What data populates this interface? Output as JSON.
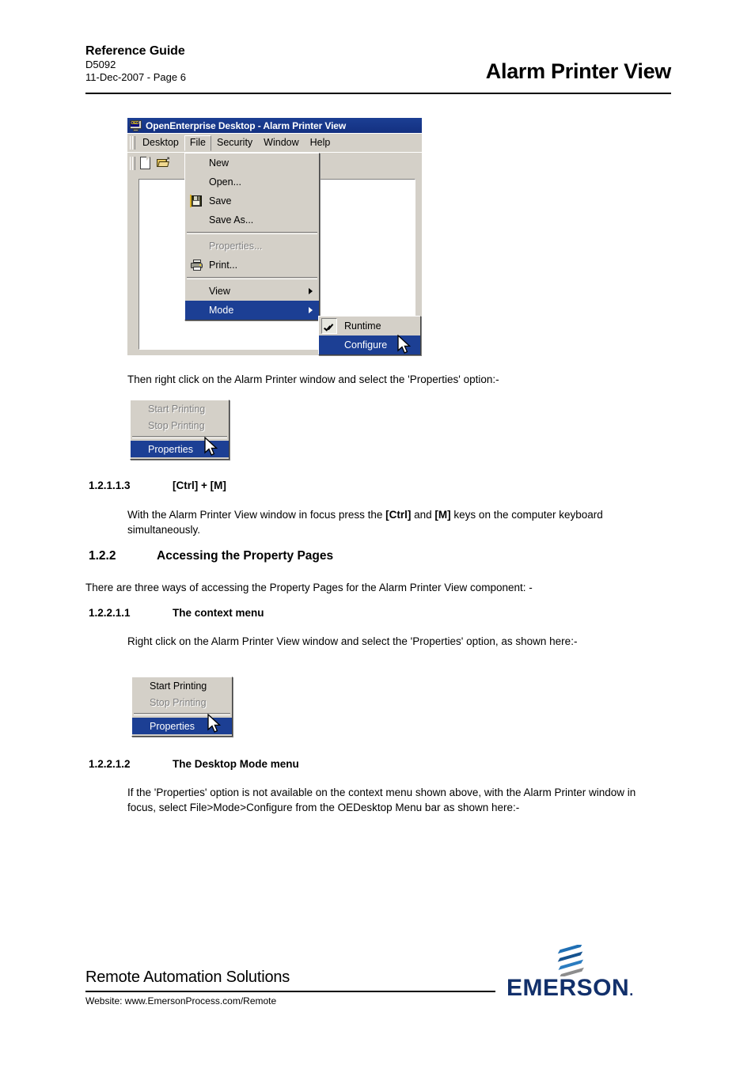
{
  "header": {
    "reference_guide": "Reference Guide",
    "doc_number": "D5092",
    "date_page": "11-Dec-2007 - Page 6",
    "title": "Alarm Printer View"
  },
  "figure_desktop_menu": {
    "titlebar": {
      "icon": "oed-monitor-icon",
      "icon_text": "OED",
      "text": "OpenEnterprise Desktop - Alarm Printer View"
    },
    "menubar": [
      {
        "label": "Desktop",
        "open": false
      },
      {
        "label": "File",
        "open": true
      },
      {
        "label": "Security",
        "open": false
      },
      {
        "label": "Window",
        "open": false
      },
      {
        "label": "Help",
        "open": false
      }
    ],
    "toolbar": [
      {
        "icon": "new-document-icon",
        "label": "New"
      },
      {
        "icon": "open-folder-icon",
        "label": "Open"
      }
    ],
    "file_menu": [
      {
        "label": "New",
        "icon": null,
        "state": "normal",
        "submenu": false
      },
      {
        "label": "Open...",
        "icon": null,
        "state": "normal",
        "submenu": false
      },
      {
        "label": "Save",
        "icon": "floppy-disk-icon",
        "state": "normal",
        "submenu": false
      },
      {
        "label": "Save As...",
        "icon": null,
        "state": "normal",
        "submenu": false
      },
      {
        "separator": true
      },
      {
        "label": "Properties...",
        "icon": null,
        "state": "disabled",
        "submenu": false
      },
      {
        "label": "Print...",
        "icon": "printer-icon",
        "state": "normal",
        "submenu": false
      },
      {
        "separator": true
      },
      {
        "label": "View",
        "icon": null,
        "state": "normal",
        "submenu": true
      },
      {
        "label": "Mode",
        "icon": null,
        "state": "selected",
        "submenu": true
      }
    ],
    "mode_submenu": [
      {
        "label": "Runtime",
        "checked": true,
        "state": "normal"
      },
      {
        "label": "Configure",
        "checked": false,
        "state": "selected"
      }
    ],
    "cursor": "arrow-cursor"
  },
  "para_then_right_click": "Then right click on the Alarm Printer window and select the 'Properties' option:-",
  "figure_context_menu_1": {
    "items": [
      {
        "label": "Start Printing",
        "state": "disabled"
      },
      {
        "label": "Stop Printing",
        "state": "disabled"
      },
      {
        "separator": true
      },
      {
        "label": "Properties",
        "state": "selected"
      }
    ],
    "cursor": "arrow-cursor"
  },
  "section_ctrl_m": {
    "number": "1.2.1.1.3",
    "title": "[Ctrl] + [M]",
    "body_part1": "With the Alarm Printer View window in focus press the ",
    "body_bold1": "[Ctrl]",
    "body_part2": " and ",
    "body_bold2": "[M]",
    "body_part3": " keys on the computer keyboard simultaneously."
  },
  "section_accessing": {
    "number": "1.2.2",
    "title": "Accessing the Property Pages",
    "body": "There are three ways of accessing the Property Pages for the Alarm Printer View component: -"
  },
  "section_context_menu": {
    "number": "1.2.2.1.1",
    "title": "The context menu",
    "body": "Right click on the Alarm Printer View window and select the 'Properties' option, as shown here:-"
  },
  "figure_context_menu_2": {
    "items": [
      {
        "label": "Start Printing",
        "state": "normal"
      },
      {
        "label": "Stop Printing",
        "state": "disabled"
      },
      {
        "separator": true
      },
      {
        "label": "Properties",
        "state": "selected"
      }
    ],
    "cursor": "arrow-cursor"
  },
  "section_desktop_mode": {
    "number": "1.2.2.1.2",
    "title": "The Desktop Mode menu",
    "body": "If the 'Properties' option is not available on the context menu shown above, with the Alarm Printer window in focus, select File>Mode>Configure from the OEDesktop Menu bar as shown here:-"
  },
  "footer": {
    "title": "Remote Automation Solutions",
    "website": "Website:  www.EmersonProcess.com/Remote",
    "logo_text": "EMERSON",
    "logo_mark": "emerson-chevron-mark"
  },
  "colors": {
    "titlebar_blue": "#1c3f94",
    "menu_face": "#d4d0c8",
    "highlight": "#1c3f94",
    "disabled_text": "#808080",
    "emerson_navy": "#12306b",
    "emerson_blue": "#1f6fb4"
  }
}
